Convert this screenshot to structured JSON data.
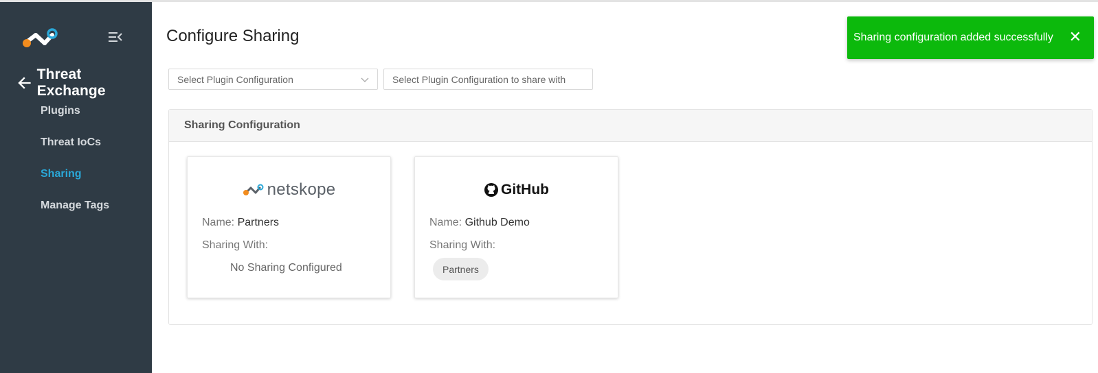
{
  "app": {
    "section_title": "Threat Exchange"
  },
  "sidebar": {
    "items": [
      {
        "label": "Plugins",
        "active": false
      },
      {
        "label": "Threat IoCs",
        "active": false
      },
      {
        "label": "Sharing",
        "active": true
      },
      {
        "label": "Manage Tags",
        "active": false
      }
    ]
  },
  "page": {
    "title": "Configure Sharing"
  },
  "filters": {
    "source_placeholder": "Select Plugin Configuration",
    "target_placeholder": "Select Plugin Configuration to share with"
  },
  "toast": {
    "message": "Sharing configuration added successfully",
    "color": "#0cb90c",
    "close_icon": "close-icon"
  },
  "panel": {
    "title": "Sharing Configuration",
    "cards": [
      {
        "brand": "netskope",
        "name_label": "Name:",
        "name_value": "Partners",
        "sharing_label": "Sharing With:",
        "sharing_empty": "No Sharing Configured"
      },
      {
        "brand": "GitHub",
        "name_label": "Name:",
        "name_value": "Github Demo",
        "sharing_label": "Sharing With:",
        "sharing_chip": "Partners"
      }
    ]
  },
  "colors": {
    "sidebar_bg": "#2f3b45",
    "active_nav": "#2aa8d8",
    "logo_orange": "#f28c1e",
    "logo_blue": "#2aa8d8"
  }
}
